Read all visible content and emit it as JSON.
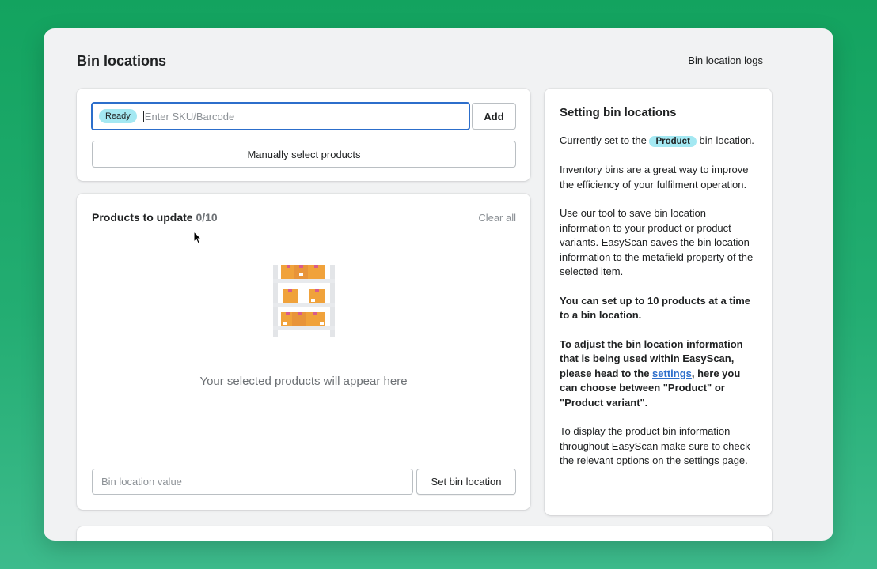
{
  "page": {
    "title": "Bin locations",
    "logs_link": "Bin location logs"
  },
  "scan": {
    "status_badge": "Ready",
    "placeholder": "Enter SKU/Barcode",
    "add_label": "Add",
    "manual_label": "Manually select products"
  },
  "products": {
    "title": "Products to update",
    "count": "0/10",
    "clear_label": "Clear all",
    "empty_text": "Your selected products will appear here",
    "bin_placeholder": "Bin location value",
    "set_label": "Set bin location"
  },
  "info": {
    "title": "Setting bin locations",
    "p1_before": "Currently set to the",
    "p1_badge": "Product",
    "p1_after": "bin location.",
    "p2": "Inventory bins are a great way to improve the efficiency of your fulfilment operation.",
    "p3": "Use our tool to save bin location information to your product or product variants. EasyScan saves the bin location information to the metafield property of the selected item.",
    "p4": "You can set up to 10 products at a time to a bin location.",
    "p5_before": "To adjust the bin location information that is being used within EasyScan, please head to the",
    "p5_link": "settings",
    "p5_after": ", here you can choose between \"Product\" or \"Product variant\".",
    "p6": "To display the product bin information throughout EasyScan make sure to check the relevant options on the settings page."
  },
  "colors": {
    "accent": "#2c6ecb",
    "badge": "#a4e8f2",
    "background_green": "#13a35f",
    "box_orange": "#f0a23b"
  },
  "icons": {
    "shelf": "warehouse-shelf-icon",
    "cursor": "mouse-pointer-icon"
  }
}
